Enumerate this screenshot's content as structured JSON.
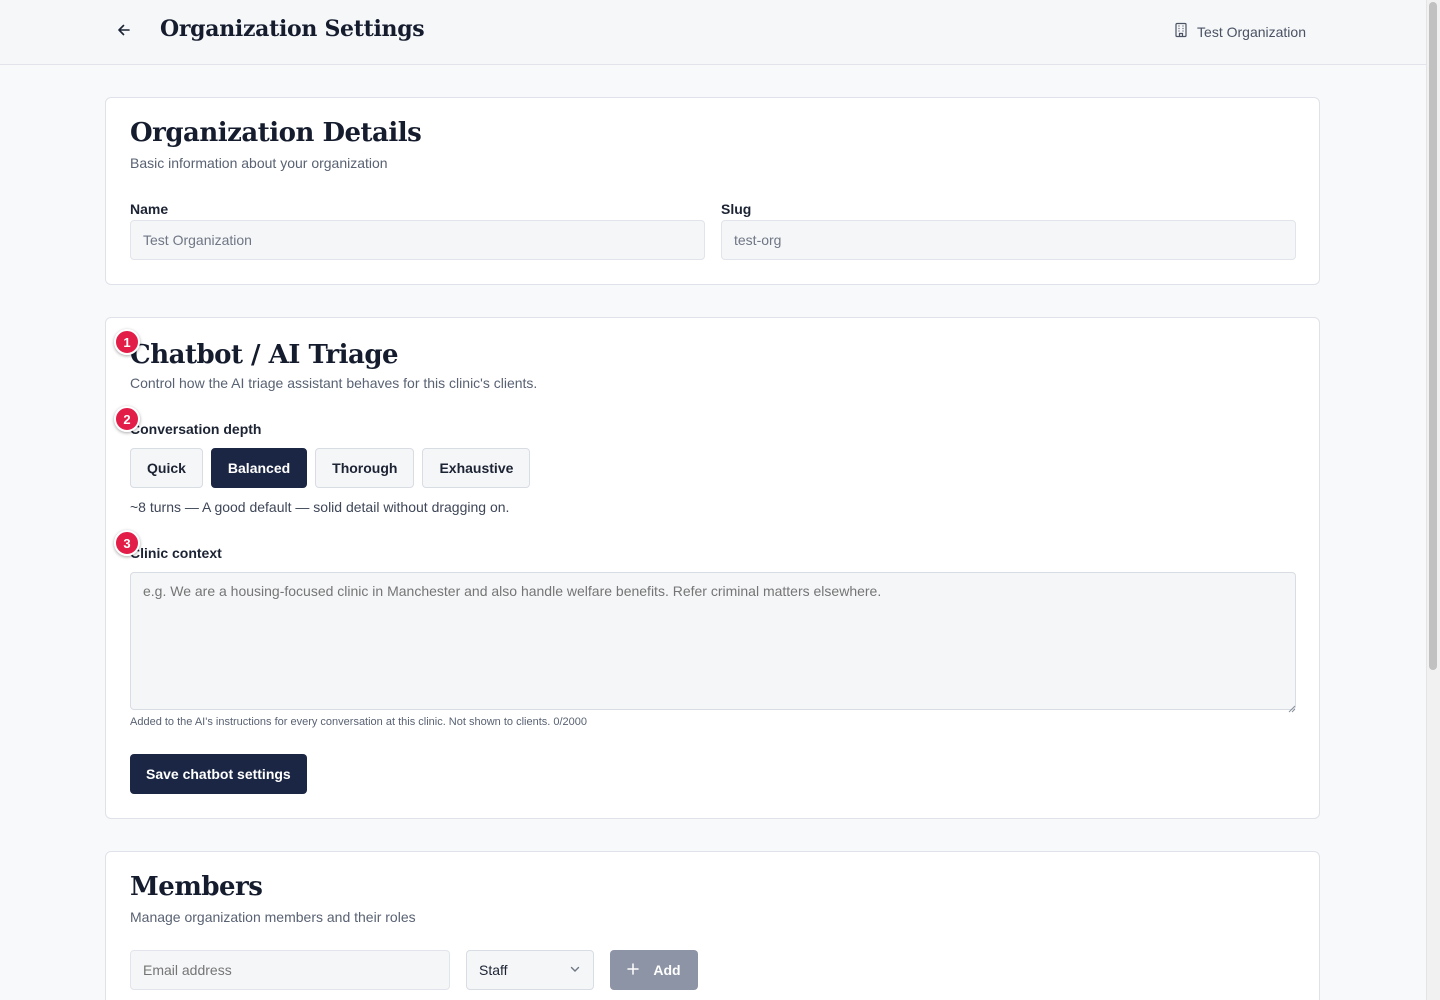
{
  "header": {
    "back_icon": "arrow-left-icon",
    "title": "Organization Settings",
    "org_icon": "building-icon",
    "org_name": "Test Organization"
  },
  "org_details": {
    "title": "Organization Details",
    "subtitle": "Basic information about your organization",
    "name_label": "Name",
    "name_value": "Test Organization",
    "slug_label": "Slug",
    "slug_value": "test-org"
  },
  "chatbot": {
    "title": "Chatbot / AI Triage",
    "subtitle": "Control how the AI triage assistant behaves for this clinic's clients.",
    "depth_label": "Conversation depth",
    "depth_options": [
      {
        "label": "Quick"
      },
      {
        "label": "Balanced"
      },
      {
        "label": "Thorough"
      },
      {
        "label": "Exhaustive"
      }
    ],
    "depth_selected": "Balanced",
    "depth_hint": "~8 turns — A good default — solid detail without dragging on.",
    "context_label": "Clinic context",
    "context_placeholder": "e.g. We are a housing-focused clinic in Manchester and also handle welfare benefits. Refer criminal matters elsewhere.",
    "context_hint": "Added to the AI's instructions for every conversation at this clinic. Not shown to clients. 0/2000",
    "save_label": "Save chatbot settings"
  },
  "members": {
    "title": "Members",
    "subtitle": "Manage organization members and their roles",
    "email_placeholder": "Email address",
    "role_value": "Staff",
    "add_label": "Add"
  },
  "markers": [
    "1",
    "2",
    "3"
  ],
  "colors": {
    "primary": "#1b2644",
    "marker": "#e11d48",
    "disabled_button": "#8d94a5",
    "page_bg": "#f8f9fb"
  }
}
